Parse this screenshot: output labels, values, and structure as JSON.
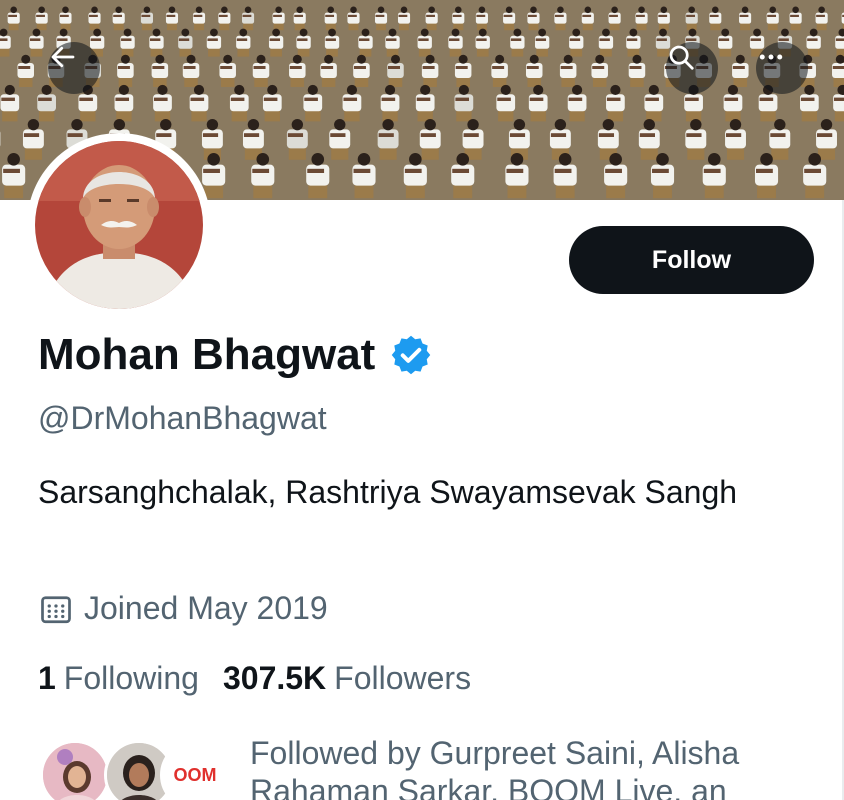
{
  "profile": {
    "name": "Mohan Bhagwat",
    "handle": "@DrMohanBhagwat",
    "bio": "Sarsanghchalak, Rashtriya Swayamsevak Sangh",
    "joined": "Joined May 2019",
    "verified": true
  },
  "stats": {
    "following_count": "1",
    "following_label": "Following",
    "followers_count": "307.5K",
    "followers_label": "Followers"
  },
  "actions": {
    "follow_label": "Follow"
  },
  "followed_by": {
    "text": "Followed by Gurpreet Saini, Alisha Rahaman Sarkar, BOOM Live, an",
    "mini_avatar_text": "OOM"
  },
  "icons": {
    "back": "arrow-left-icon",
    "search": "search-icon",
    "more": "more-icon",
    "verified": "verified-badge-icon",
    "calendar": "calendar-icon"
  },
  "colors": {
    "primary_text": "#0f1419",
    "secondary_text": "#536471",
    "verified_blue": "#1d9bf0",
    "follow_button": "#0f1419"
  }
}
